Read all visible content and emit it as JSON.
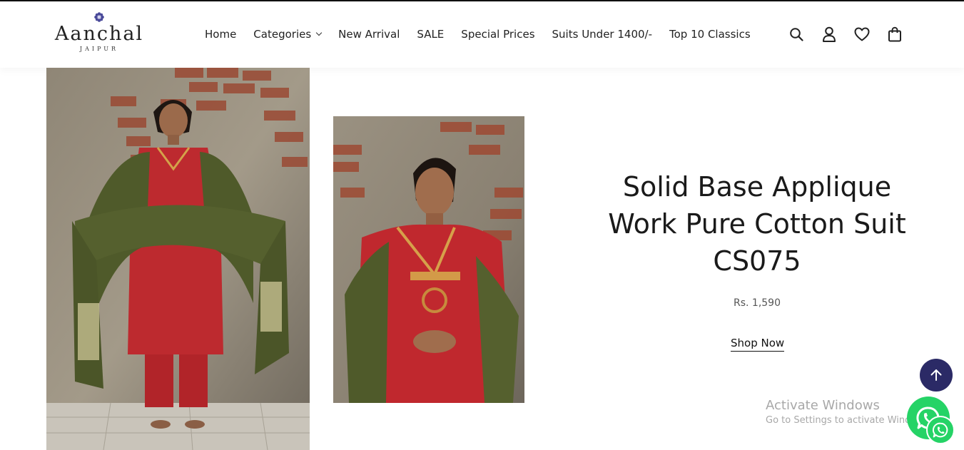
{
  "header": {
    "logo": {
      "brand": "Aanchal",
      "city": "JAIPUR"
    },
    "nav": [
      {
        "label": "Home"
      },
      {
        "label": "Categories",
        "has_dropdown": true
      },
      {
        "label": "New Arrival"
      },
      {
        "label": "SALE"
      },
      {
        "label": "Special Prices"
      },
      {
        "label": "Suits Under 1400/-"
      },
      {
        "label": "Top 10 Classics"
      }
    ],
    "icons": [
      "search-icon",
      "account-icon",
      "wishlist-heart-icon",
      "cart-bag-icon"
    ]
  },
  "product": {
    "title": "Solid Base Applique Work Pure Cotton Suit CS075",
    "price": "Rs. 1,590",
    "cta": "Shop Now",
    "images": [
      "model-full-length-red-suit-green-dupatta",
      "model-close-up-red-kurta"
    ]
  },
  "overlay": {
    "activate_title": "Activate Windows",
    "activate_sub": "Go to Settings to activate Windows."
  },
  "colors": {
    "accent": "#2b2a66",
    "whatsapp": "#25d366",
    "text": "#222222",
    "suit_red": "#b8232b",
    "dupatta_green": "#4f5a2a"
  }
}
